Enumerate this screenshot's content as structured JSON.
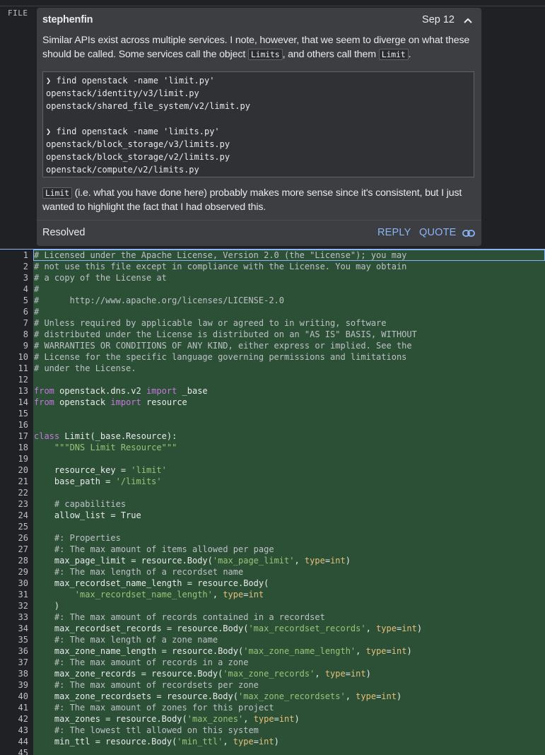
{
  "file_label": "FILE",
  "comment": {
    "author": "stephenfin",
    "date": "Sep 12",
    "message_before": "Similar APIs exist across multiple services. I note, however, that we seem to diverge on what these should be called. Some services call the object ",
    "code1": "Limits",
    "message_mid": ", and others call them ",
    "code2": "Limit",
    "message_end": ".",
    "pre_lines": [
      "❯ find openstack -name 'limit.py'",
      "openstack/identity/v3/limit.py",
      "openstack/shared_file_system/v2/limit.py",
      "",
      "❯ find openstack -name 'limits.py'",
      "openstack/block_storage/v3/limits.py",
      "openstack/block_storage/v2/limits.py",
      "openstack/compute/v2/limits.py"
    ],
    "followup_code": "Limit",
    "followup_text": " (i.e. what you have done here) probably makes more sense since it's consistent, but I just wanted to highlight the fact that I had observed this.",
    "resolved_label": "Resolved",
    "reply_label": "REPLY",
    "quote_label": "QUOTE"
  },
  "code_lines": [
    [
      [
        "c",
        "# Licensed under the Apache License, Version 2.0 (the \"License\"); you may"
      ]
    ],
    [
      [
        "c",
        "# not use this file except in compliance with the License. You may obtain"
      ]
    ],
    [
      [
        "c",
        "# a copy of the License at"
      ]
    ],
    [
      [
        "c",
        "#"
      ]
    ],
    [
      [
        "c",
        "#      http://www.apache.org/licenses/LICENSE-2.0"
      ]
    ],
    [
      [
        "c",
        "#"
      ]
    ],
    [
      [
        "c",
        "# Unless required by applicable law or agreed to in writing, software"
      ]
    ],
    [
      [
        "c",
        "# distributed under the License is distributed on an \"AS IS\" BASIS, WITHOUT"
      ]
    ],
    [
      [
        "c",
        "# WARRANTIES OR CONDITIONS OF ANY KIND, either express or implied. See the"
      ]
    ],
    [
      [
        "c",
        "# License for the specific language governing permissions and limitations"
      ]
    ],
    [
      [
        "c",
        "# under the License."
      ]
    ],
    [],
    [
      [
        "k",
        "from"
      ],
      [
        "n",
        " openstack.dns.v2 "
      ],
      [
        "k",
        "import"
      ],
      [
        "n",
        " _base"
      ]
    ],
    [
      [
        "k",
        "from"
      ],
      [
        "n",
        " openstack "
      ],
      [
        "k",
        "import"
      ],
      [
        "n",
        " resource"
      ]
    ],
    [],
    [],
    [
      [
        "k",
        "class"
      ],
      [
        "n",
        " Limit(_base.Resource):"
      ]
    ],
    [
      [
        "n",
        "    "
      ],
      [
        "s",
        "\"\"\"DNS Limit Resource\"\"\""
      ]
    ],
    [],
    [
      [
        "n",
        "    resource_key = "
      ],
      [
        "s",
        "'limit'"
      ]
    ],
    [
      [
        "n",
        "    base_path = "
      ],
      [
        "s",
        "'/limits'"
      ]
    ],
    [],
    [
      [
        "n",
        "    "
      ],
      [
        "c",
        "# capabilities"
      ]
    ],
    [
      [
        "n",
        "    allow_list = True"
      ]
    ],
    [],
    [
      [
        "n",
        "    "
      ],
      [
        "c",
        "#: Properties"
      ]
    ],
    [
      [
        "n",
        "    "
      ],
      [
        "c",
        "#: The max amount of items allowed per page"
      ]
    ],
    [
      [
        "n",
        "    max_page_limit = resource.Body("
      ],
      [
        "s",
        "'max_page_limit'"
      ],
      [
        "n",
        ", "
      ],
      [
        "a",
        "type"
      ],
      [
        "n",
        "="
      ],
      [
        "a",
        "int"
      ],
      [
        "n",
        ")"
      ]
    ],
    [
      [
        "n",
        "    "
      ],
      [
        "c",
        "#: The max length of a recordset name"
      ]
    ],
    [
      [
        "n",
        "    max_recordset_name_length = resource.Body("
      ]
    ],
    [
      [
        "n",
        "        "
      ],
      [
        "s",
        "'max_recordset_name_length'"
      ],
      [
        "n",
        ", "
      ],
      [
        "a",
        "type"
      ],
      [
        "n",
        "="
      ],
      [
        "a",
        "int"
      ]
    ],
    [
      [
        "n",
        "    )"
      ]
    ],
    [
      [
        "n",
        "    "
      ],
      [
        "c",
        "#: The max amount of records contained in a recordset"
      ]
    ],
    [
      [
        "n",
        "    max_recordset_records = resource.Body("
      ],
      [
        "s",
        "'max_recordset_records'"
      ],
      [
        "n",
        ", "
      ],
      [
        "a",
        "type"
      ],
      [
        "n",
        "="
      ],
      [
        "a",
        "int"
      ],
      [
        "n",
        ")"
      ]
    ],
    [
      [
        "n",
        "    "
      ],
      [
        "c",
        "#: The max length of a zone name"
      ]
    ],
    [
      [
        "n",
        "    max_zone_name_length = resource.Body("
      ],
      [
        "s",
        "'max_zone_name_length'"
      ],
      [
        "n",
        ", "
      ],
      [
        "a",
        "type"
      ],
      [
        "n",
        "="
      ],
      [
        "a",
        "int"
      ],
      [
        "n",
        ")"
      ]
    ],
    [
      [
        "n",
        "    "
      ],
      [
        "c",
        "#: The max amount of records in a zone"
      ]
    ],
    [
      [
        "n",
        "    max_zone_records = resource.Body("
      ],
      [
        "s",
        "'max_zone_records'"
      ],
      [
        "n",
        ", "
      ],
      [
        "a",
        "type"
      ],
      [
        "n",
        "="
      ],
      [
        "a",
        "int"
      ],
      [
        "n",
        ")"
      ]
    ],
    [
      [
        "n",
        "    "
      ],
      [
        "c",
        "#: The max amount of recordsets per zone"
      ]
    ],
    [
      [
        "n",
        "    max_zone_recordsets = resource.Body("
      ],
      [
        "s",
        "'max_zone_recordsets'"
      ],
      [
        "n",
        ", "
      ],
      [
        "a",
        "type"
      ],
      [
        "n",
        "="
      ],
      [
        "a",
        "int"
      ],
      [
        "n",
        ")"
      ]
    ],
    [
      [
        "n",
        "    "
      ],
      [
        "c",
        "#: The max amount of zones for this project"
      ]
    ],
    [
      [
        "n",
        "    max_zones = resource.Body("
      ],
      [
        "s",
        "'max_zones'"
      ],
      [
        "n",
        ", "
      ],
      [
        "a",
        "type"
      ],
      [
        "n",
        "="
      ],
      [
        "a",
        "int"
      ],
      [
        "n",
        ")"
      ]
    ],
    [
      [
        "n",
        "    "
      ],
      [
        "c",
        "#: The lowest ttl allowed on this system"
      ]
    ],
    [
      [
        "n",
        "    min_ttl = resource.Body("
      ],
      [
        "s",
        "'min_ttl'"
      ],
      [
        "n",
        ", "
      ],
      [
        "a",
        "type"
      ],
      [
        "n",
        "="
      ],
      [
        "a",
        "int"
      ],
      [
        "n",
        ")"
      ]
    ],
    []
  ]
}
